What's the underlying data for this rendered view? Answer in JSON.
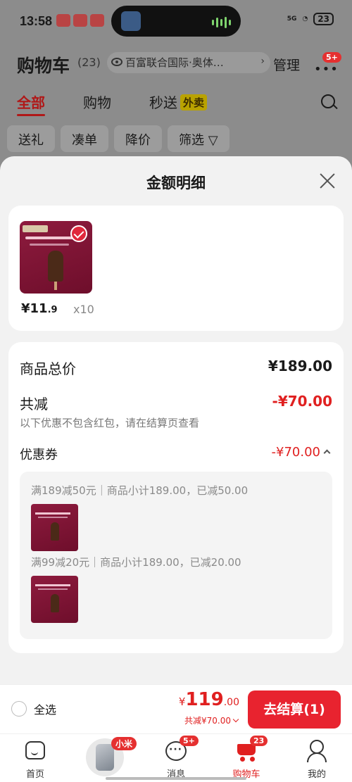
{
  "status_bar": {
    "time": "13:58",
    "network": "5G",
    "battery": "23"
  },
  "cart_header": {
    "title": "购物车",
    "count": "(23)",
    "location": "百富联合国际·奥体…",
    "manage": "管理",
    "more_badge": "5+"
  },
  "tabs": [
    {
      "label": "全部",
      "active": true
    },
    {
      "label": "购物",
      "active": false
    },
    {
      "label": "秒送",
      "active": false,
      "tag": "外卖"
    }
  ],
  "filter_chips": [
    "送礼",
    "凑单",
    "降价",
    "筛选"
  ],
  "sheet": {
    "title": "金额明细",
    "product": {
      "price_main": "¥11",
      "price_decimal": ".9",
      "quantity": "x10"
    },
    "goods_total_label": "商品总价",
    "goods_total_value": "¥189.00",
    "discount_label": "共减",
    "discount_value": "-¥70.00",
    "note": "以下优惠不包含红包，请在结算页查看",
    "coupon_label": "优惠券",
    "coupon_value": "-¥70.00",
    "coupons": [
      {
        "text": "满189减50元｜商品小计189.00，已减50.00"
      },
      {
        "text": "满99减20元｜商品小计189.00，已减20.00"
      }
    ]
  },
  "checkout": {
    "select_all": "全选",
    "currency": "¥",
    "total_main": "119",
    "total_decimal": ".00",
    "saved": "共减¥70.00",
    "button": "去结算(1)"
  },
  "nav": [
    {
      "label": "首页",
      "icon": "home-icon"
    },
    {
      "label": "",
      "icon": "phone-thumbnail",
      "tag": "小米"
    },
    {
      "label": "消息",
      "icon": "message-icon",
      "badge": "5+"
    },
    {
      "label": "购物车",
      "icon": "cart-icon",
      "badge": "23",
      "active": true
    },
    {
      "label": "我的",
      "icon": "profile-icon"
    }
  ],
  "colors": {
    "accent_red": "#e02020",
    "button_red": "#e8232f",
    "product_bg": "#8e1b3e"
  }
}
